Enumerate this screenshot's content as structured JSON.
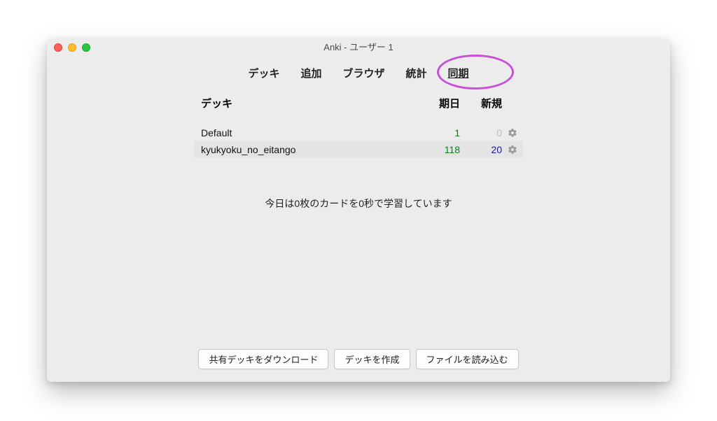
{
  "window": {
    "title": "Anki - ユーザー 1"
  },
  "toolbar": {
    "decks": "デッキ",
    "add": "追加",
    "browser": "ブラウザ",
    "stats": "統計",
    "sync": "同期"
  },
  "columns": {
    "deck": "デッキ",
    "due": "期日",
    "new": "新規"
  },
  "decks": [
    {
      "name": "Default",
      "due": "1",
      "new": "0",
      "new_zero": true
    },
    {
      "name": "kyukyoku_no_eitango",
      "due": "118",
      "new": "20",
      "new_zero": false
    }
  ],
  "status": "今日は0枚のカードを0秒で学習しています",
  "footer": {
    "download_shared": "共有デッキをダウンロード",
    "create_deck": "デッキを作成",
    "import_file": "ファイルを読み込む"
  }
}
